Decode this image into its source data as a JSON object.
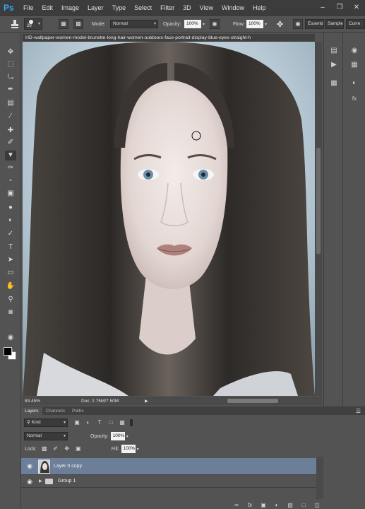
{
  "app": {
    "logo": "Ps",
    "menus": [
      "File",
      "Edit",
      "Image",
      "Layer",
      "Type",
      "Select",
      "Filter",
      "3D",
      "View",
      "Window",
      "Help"
    ],
    "window_controls": [
      "minimize-icon",
      "restore-icon",
      "close-icon"
    ]
  },
  "options": {
    "brush_size": "29",
    "mode_label": "Mode:",
    "mode_value": "Normal",
    "opacity_label": "Opacity:",
    "opacity_value": "100%",
    "flow_label": "Flow:",
    "flow_value": "100%",
    "workspace_essentials": "Essentials",
    "workspace_samples": "Samples",
    "workspace_current": "Curre"
  },
  "document": {
    "tab_title": "HD-wallpaper-women-model-brunette-long-hair-women-outdoors-face-portrait-display-blue-eyes-straight-h",
    "zoom": "83.45%",
    "doc_info": "Doc: 2.75M/7.50M"
  },
  "layers_panel": {
    "tabs": [
      "Layers",
      "Channels",
      "Paths"
    ],
    "filter_kind": "Kind",
    "blend_mode": "Normal",
    "opacity_label": "Opacity:",
    "opacity_value": "100%",
    "lock_label": "Lock:",
    "fill_label": "Fill:",
    "fill_value": "100%",
    "layers": [
      {
        "name": "Layer 0 copy",
        "selected": true
      },
      {
        "name": "Group 1",
        "selected": false
      }
    ]
  },
  "colors": {
    "accent": "#31a8ff",
    "selection": "#6d7e99",
    "foreground": "#000000",
    "background": "#ffffff"
  }
}
